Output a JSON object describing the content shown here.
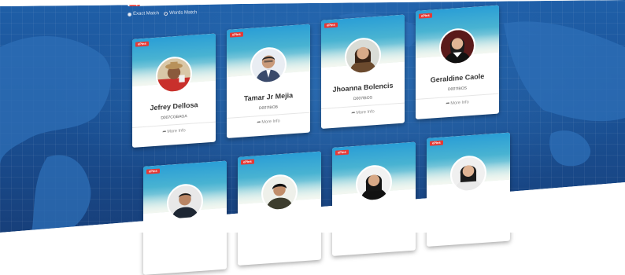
{
  "search": {
    "options": [
      {
        "label": "Exact Match",
        "selected": false
      },
      {
        "label": "Words Match",
        "selected": true
      }
    ]
  },
  "cards": [
    {
      "badge": "ePins",
      "name": "Jefrey Dellosa",
      "code": "D007CGBAGA",
      "more": "More Info",
      "avatar_icon": "person-hat-avatar"
    },
    {
      "badge": "ePins",
      "name": "Tamar Jr Mejia",
      "code": "D007IBOB",
      "more": "More Info",
      "avatar_icon": "person-suit-avatar"
    },
    {
      "badge": "ePins",
      "name": "Jhoanna Bolencis",
      "code": "D007IBOS",
      "more": "More Info",
      "avatar_icon": "person-woman-avatar"
    },
    {
      "badge": "ePins",
      "name": "Geraldine Caole",
      "code": "D007IBOS",
      "more": "More Info",
      "avatar_icon": "person-graduate-avatar"
    },
    {
      "badge": "ePins",
      "name": "",
      "code": "",
      "more": "",
      "avatar_icon": "person-man-avatar"
    },
    {
      "badge": "ePins",
      "name": "",
      "code": "",
      "more": "",
      "avatar_icon": "person-man-avatar"
    },
    {
      "badge": "ePins",
      "name": "",
      "code": "",
      "more": "",
      "avatar_icon": "person-woman-avatar"
    },
    {
      "badge": "ePins",
      "name": "",
      "code": "",
      "more": "",
      "avatar_icon": "person-woman-avatar"
    }
  ],
  "colors": {
    "background": "#1a4f92",
    "accent": "#e53935",
    "card_band": "#2a9ed6"
  }
}
